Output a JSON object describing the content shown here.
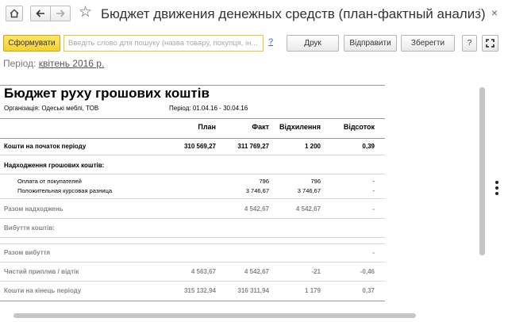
{
  "window": {
    "title": "Бюджет движения денежных средств (план-фактный анализ)",
    "icons": {
      "home": "home-icon",
      "back": "arrow-left-icon",
      "forward": "arrow-right-icon",
      "favorite": "star-icon",
      "more": "more-vertical-icon",
      "fullscreen": "expand-icon"
    }
  },
  "toolbar": {
    "generate_label": "Сформувати",
    "search_placeholder": "Введіть слово для пошуку (назва товару, покупця, ін...",
    "help_label": "?",
    "print_label": "Друк",
    "send_label": "Відправити",
    "save_label": "Зберегти",
    "question_label": "?"
  },
  "period": {
    "label": "Період:",
    "value": "квітень 2016 р."
  },
  "report": {
    "title": "Бюджет руху грошових коштів",
    "organization": "Організація: Одеські меблі, ТОВ",
    "period": "Період: 01.04.16 - 30.04.16",
    "columns": [
      "План",
      "Факт",
      "Відхилення",
      "Відсоток"
    ],
    "rows": [
      {
        "label": "Кошти на початок періоду",
        "plan": "310 569,27",
        "fact": "311 769,27",
        "deviation": "1 200",
        "percent": "0,39"
      },
      {
        "label": "Надходження грошових коштів:",
        "plan": "",
        "fact": "",
        "deviation": "",
        "percent": ""
      },
      {
        "label": "Оплата от покупателей",
        "plan": "",
        "fact": "796",
        "deviation": "796",
        "percent": "-"
      },
      {
        "label": "Положительная курсовая разница",
        "plan": "",
        "fact": "3 746,67",
        "deviation": "3 746,67",
        "percent": "-"
      },
      {
        "label": "Разом надходжень",
        "plan": "",
        "fact": "4 542,67",
        "deviation": "4 542,67",
        "percent": "-"
      },
      {
        "label": "Вибуття коштів:",
        "plan": "",
        "fact": "",
        "deviation": "",
        "percent": ""
      },
      {
        "label": "Разом вибуття",
        "plan": "",
        "fact": "",
        "deviation": "",
        "percent": "-"
      },
      {
        "label": "Чистий приплив / відтік",
        "plan": "4 563,67",
        "fact": "4 542,67",
        "deviation": "-21",
        "percent": "-0,46"
      },
      {
        "label": "Кошти на кінець періоду",
        "plan": "315 132,94",
        "fact": "316 311,94",
        "deviation": "1 179",
        "percent": "0,37"
      }
    ]
  }
}
